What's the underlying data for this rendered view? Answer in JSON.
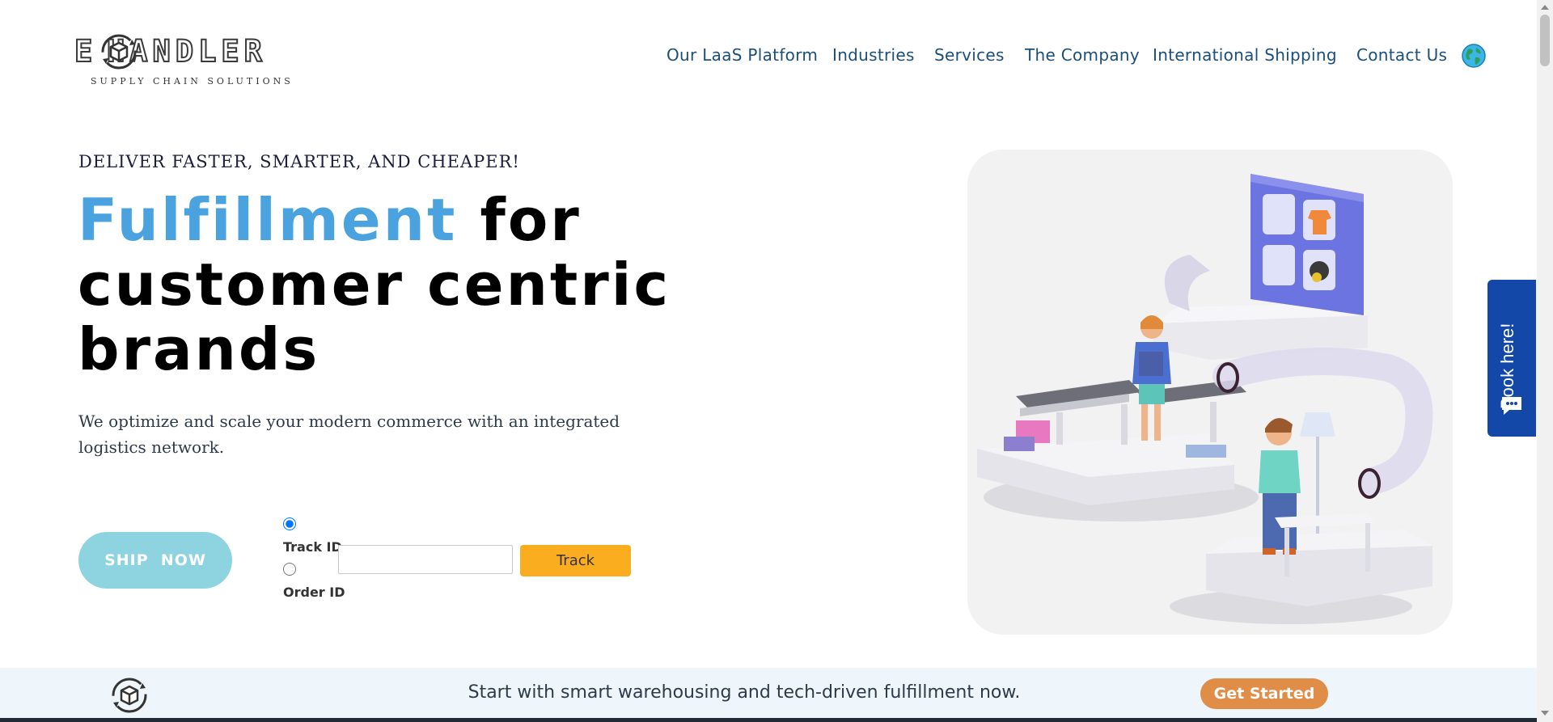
{
  "brand": {
    "logo_word": "HANDLER",
    "logo_letter": "E",
    "tagline": "SUPPLY CHAIN SOLUTIONS"
  },
  "nav": {
    "items": [
      {
        "label": "Our LaaS Platform"
      },
      {
        "label": "Industries"
      },
      {
        "label": "Services"
      },
      {
        "label": "The Company"
      },
      {
        "label": "International Shipping"
      },
      {
        "label": "Contact Us"
      }
    ],
    "language_icon": "globe-icon"
  },
  "hero": {
    "tagline": "DELIVER FASTER, SMARTER, AND CHEAPER!",
    "headline_accent": "Fulfillment",
    "headline_rest": " for customer centric brands",
    "subtitle": "We optimize and scale your modern commerce with an integrated logistics network.",
    "ship_button": "SHIP  NOW",
    "illustration": "fulfillment-warehouse-illustration"
  },
  "tracking": {
    "option_track_id": "Track ID",
    "option_order_id": "Order ID",
    "selected": "Track ID",
    "input_value": "",
    "input_placeholder": "",
    "button": "Track"
  },
  "side_tab": {
    "label": "Book here!",
    "icon": "chat-icon"
  },
  "banner": {
    "text": "Start with smart warehousing and tech-driven fulfillment now.",
    "button": "Get Started"
  },
  "colors": {
    "accent_blue": "#4aa3df",
    "nav_text": "#1b4f7a",
    "ship_button": "#8dd4e0",
    "track_button": "#fbad20",
    "book_tab": "#1347a8",
    "get_started": "#e08d47",
    "banner_bg": "#eef6fb"
  }
}
